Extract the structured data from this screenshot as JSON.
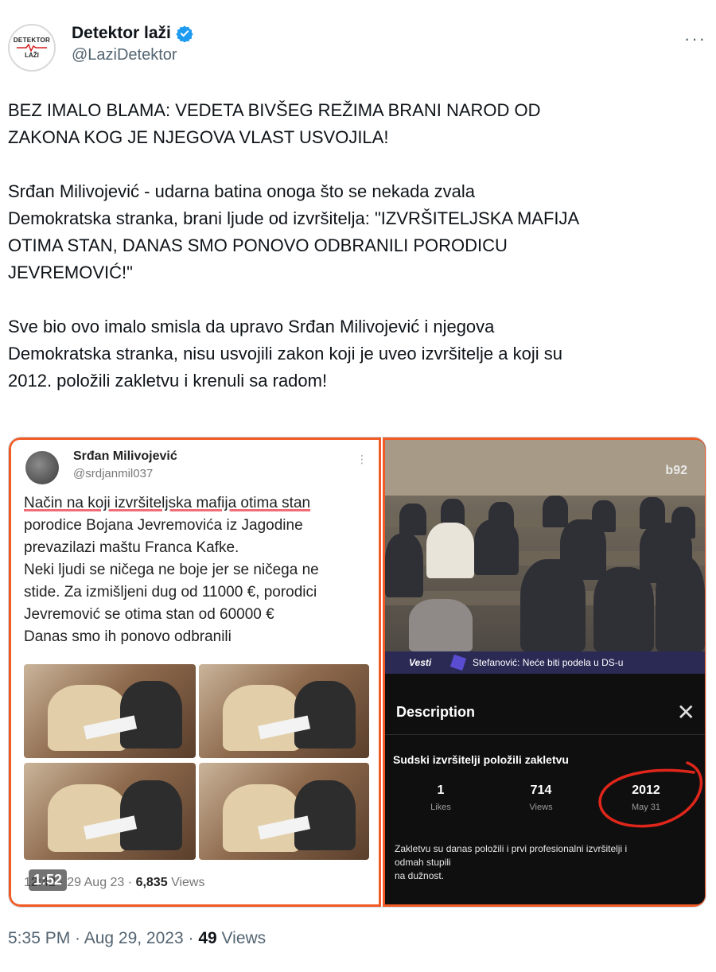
{
  "author": {
    "display_name": "Detektor laži",
    "handle": "@LaziDetektor",
    "avatar_top": "DETEKTOR",
    "avatar_bottom": "LAŽI"
  },
  "tweet": {
    "paragraph1_line1": "BEZ IMALO BLAMA: VEDETA BIVŠEG REŽIMA BRANI NAROD OD",
    "paragraph1_line2": "ZAKONA KOG JE NJEGOVA VLAST USVOJILA!",
    "paragraph2_line1": "Srđan Milivojević - udarna batina onoga što se nekada zvala",
    "paragraph2_line2": "Demokratska stranka, brani ljude od izvršitelja: \"IZVRŠITELJSKA MAFIJA",
    "paragraph2_line3": "OTIMA STAN, DANAS SMO PONOVO ODBRANILI PORODICU",
    "paragraph2_line4": "JEVREMOVIĆ!\"",
    "paragraph3_line1": "Sve bio ovo imalo smisla da upravo Srđan Milivojević i njegova",
    "paragraph3_line2": "Demokratska stranka, nisu usvojili zakon koji je uveo izvršitelje a koji su",
    "paragraph3_line3": "2012. položili zakletvu i krenuli sa radom!"
  },
  "embedded_tweet": {
    "name": "Srđan Milivojević",
    "handle": "@srdjanmil037",
    "line1": "Način na koji izvršiteljska mafija otima stan",
    "line2": "porodice Bojana Jevremovića iz Jagodine",
    "line3": "prevazilazi maštu Franca Kafke.",
    "line4": "Neki ljudi se ničega ne boje jer se ničega ne",
    "line5": "stide. Za izmišljeni dug od 11000 €, porodici",
    "line6": "Jevremović se otima stan od 60000 €",
    "line7": "Danas smo ih ponovo odbranili",
    "footer_date": "12:42 · 29 Aug 23 ·",
    "footer_views": "6,835",
    "footer_views_label": "Views"
  },
  "video": {
    "duration": "1:52",
    "channel_logo": "b92",
    "ticker_brand": "Vesti",
    "ticker_text": "Stefanović: Neće biti podela u DS-u"
  },
  "description": {
    "title": "Description",
    "video_title": "Sudski izvršitelji položili zakletvu",
    "stats": [
      {
        "value": "1",
        "label": "Likes"
      },
      {
        "value": "714",
        "label": "Views"
      },
      {
        "value": "2012",
        "label": "May 31"
      }
    ],
    "body_line1": "Zakletvu su danas položili i prvi profesionalni izvršitelji i",
    "body_line2": "odmah stupili",
    "body_line3": "na dužnost.",
    "highlight_color": "#e0261b"
  },
  "meta": {
    "time_date": "5:35 PM · Aug 29, 2023 ·",
    "views_count": "49",
    "views_label": "Views"
  },
  "colors": {
    "accent_border": "#f15a24",
    "verified_blue": "#1d9bf0"
  }
}
